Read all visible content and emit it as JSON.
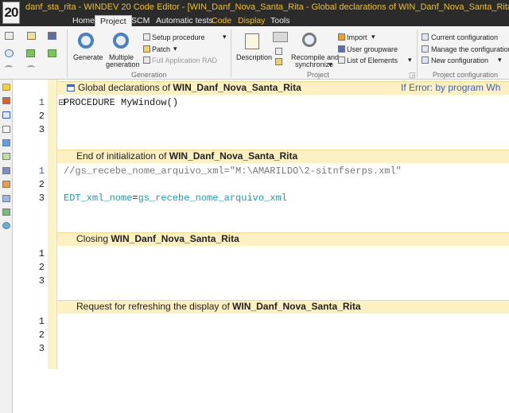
{
  "window": {
    "title": "danf_sta_rita - WINDEV 20  Code Editor - [WIN_Danf_Nova_Santa_Rita - Global declarations of WIN_Danf_Nova_Santa_Rita]",
    "logo": "20"
  },
  "menu": {
    "tabs": [
      {
        "label": "Home"
      },
      {
        "label": "Project"
      },
      {
        "label": "SCM"
      },
      {
        "label": "Automatic tests"
      },
      {
        "label": "Code"
      },
      {
        "label": "Display"
      },
      {
        "label": "Tools"
      }
    ]
  },
  "ribbon": {
    "generation": {
      "generate": "Generate",
      "multiple_1": "Multiple",
      "multiple_2": "generation",
      "setup": "Setup procedure",
      "patch": "Patch",
      "full_app_rad": "Full Application RAD",
      "group_label": "Generation"
    },
    "project": {
      "description": "Description",
      "recompile_1": "Recompile and",
      "recompile_2": "synchronize",
      "import": "Import",
      "user_groupware": "User groupware",
      "list_elements": "List of Elements",
      "group_label": "Project"
    },
    "config": {
      "current": "Current configuration",
      "manage": "Manage the configurations",
      "new": "New configuration",
      "group_label": "Project configuration"
    }
  },
  "editor": {
    "sections": [
      {
        "prefix": "Global declarations of ",
        "name": "WIN_Danf_Nova_Santa_Rita",
        "right": "If Error: by program   Wh",
        "lines": [
          "1",
          "2",
          "3"
        ],
        "code": [
          "PROCEDURE MyWindow()",
          "",
          ""
        ]
      },
      {
        "prefix": "End of initialization of ",
        "name": "WIN_Danf_Nova_Santa_Rita",
        "lines": [
          "1",
          "2",
          "3"
        ],
        "comment": "//gs_recebe_nome_arquivo_xml=\"M:\\AMARILDO\\2-sitnfserps.xml\"",
        "assign_lhs": "EDT_xml_nome",
        "assign_op": "=",
        "assign_rhs": "gs_recebe_nome_arquivo_xml"
      },
      {
        "prefix": "Closing ",
        "name": "WIN_Danf_Nova_Santa_Rita",
        "lines": [
          "1",
          "2",
          "3"
        ]
      },
      {
        "prefix": "Request for refreshing the display of ",
        "name": "WIN_Danf_Nova_Santa_Rita",
        "lines": [
          "1",
          "2",
          "3"
        ]
      }
    ]
  },
  "colors": {
    "titlebar": "#2b2b2b",
    "title_text": "#f0c020",
    "section_band": "#fdf0c2",
    "variable": "#1a9bb0",
    "comment": "#777777"
  }
}
